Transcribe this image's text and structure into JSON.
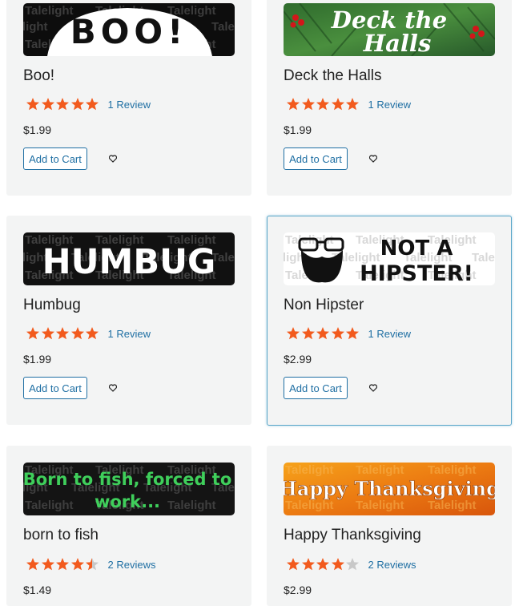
{
  "products": [
    {
      "name": "Boo!",
      "rating": 5,
      "reviews": "1 Review",
      "price": "$1.99",
      "add_label": "Add to Cart",
      "banner_text": "BOO!"
    },
    {
      "name": "Deck the Halls",
      "rating": 5,
      "reviews": "1 Review",
      "price": "$1.99",
      "add_label": "Add to Cart",
      "banner_line1": "Deck the",
      "banner_line2": "Halls"
    },
    {
      "name": "Humbug",
      "rating": 5,
      "reviews": "1 Review",
      "price": "$1.99",
      "add_label": "Add to Cart",
      "banner_text": "HUMBUG"
    },
    {
      "name": "Non Hipster",
      "rating": 5,
      "reviews": "1 Review",
      "price": "$2.99",
      "add_label": "Add to Cart",
      "banner_line1": "NOT A",
      "banner_line2": "HIPSTER!"
    },
    {
      "name": "born to fish",
      "rating": 4.5,
      "reviews": "2 Reviews",
      "price": "$1.49",
      "add_label": "Add to Cart",
      "banner_line1": "Born to fish, forced to",
      "banner_line2": "work..."
    },
    {
      "name": "Happy Thanksgiving",
      "rating": 4,
      "reviews": "2 Reviews",
      "price": "$2.99",
      "add_label": "Add to Cart",
      "banner_text": "Happy Thanksgiving"
    }
  ],
  "watermark": "Talelight",
  "colors": {
    "star": "#f25a1d",
    "star_empty": "#c8c8c8",
    "link": "#1f6fa3",
    "highlight_border": "#5aa6c9"
  }
}
